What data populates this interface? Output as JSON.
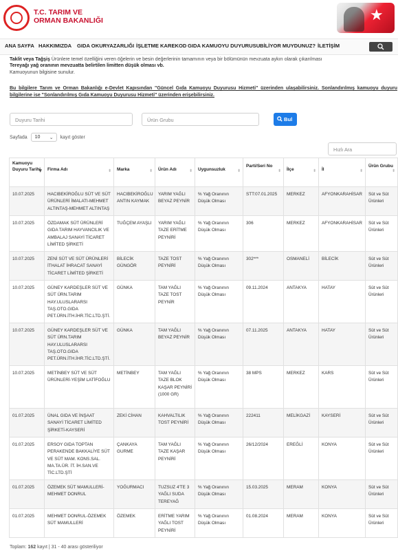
{
  "header": {
    "logo_line1": "T.C. TARIM VE",
    "logo_line2": "ORMAN BAKANLIĞI"
  },
  "nav": {
    "items": [
      "ANA SAYFA",
      "HAKKIMIZDA",
      "GIDA OKURYAZARLIĞI",
      "İŞLETME KAREKOD",
      "GIDA KAMUOYU DUYURUSU",
      "BİLİYOR MUYDUNUZ?",
      "İLETİŞİM"
    ],
    "search_icon": "search-icon"
  },
  "notice": {
    "line1_bold": "Taklit veya Tağşiş",
    "line1_rest": " Ürünlere temel özelliğini veren öğelerin ve besin değerlerinin tamamının veya bir bölümünün mevzuata aykırı olarak çıkarılması",
    "line2": "Tereyağı yağ oranının mevzuatta belirtilen limitten düşük olması vb.",
    "line3": "Kamuoyunun bilgisine sunulur."
  },
  "links_paragraph": "Bu bilgilere Tarım ve Orman Bakanlığı e-Devlet Kapısından \"Güncel Gıda Kamuoyu Duyurusu Hizmeti\" üzerinden ulaşabilirsiniz. Sonlandırılmış kamuoyu duyuru bilgilerine ise \"Sonlandırılmış Gıda Kamuoyu Duyurusu Hizmeti\" üzerinden erişebilirsiniz.",
  "filters": {
    "date_placeholder": "Duyuru Tarihi",
    "group_placeholder": "Ürün Grubu",
    "search_label": "Bul"
  },
  "pagesize": {
    "prefix": "Sayfada",
    "value": "10",
    "suffix": "kayıt göster"
  },
  "quick_search_placeholder": "Hızlı Ara",
  "table": {
    "columns": [
      "Kamuoyu Duyuru Tarihi",
      "Firma Adı",
      "Marka",
      "Ürün Adı",
      "Uygunsuzluk",
      "Parti/Seri No",
      "İlçe",
      "İl",
      "Ürün Grubu"
    ],
    "rows": [
      {
        "date": "10.07.2025",
        "firm": "HACIBEKİROĞLU SÜT VE SÜT ÜRÜNLERİ İMALATI-MEHMET ALTINTAŞ-MEHMET ALTINTAŞ",
        "brand": "HACIBEKİROĞLU ANTIN KAYMAK",
        "product": "YARIM YAĞLI BEYAZ PEYNİR",
        "issue": "% Yağ Oranının Düşük Olması",
        "lot": "STT:07.01.2025",
        "district": "MERKEZ",
        "city": "AFYONKARAHİSAR",
        "group": "Süt ve Süt Ürünleri"
      },
      {
        "date": "10.07.2025",
        "firm": "ÖZDAMAK SÜT ÜRÜNLERİ GIDA TARIM HAYVANCILIK VE AMBALAJ SANAYİ TİCARET LİMİTED ŞİRKETİ",
        "brand": "TUĞÇEM AYAŞLI",
        "product": "YARIM YAĞLI TAZE ERİTME PEYNİRİ",
        "issue": "% Yağ Oranının Düşük Olması",
        "lot": "306",
        "district": "MERKEZ",
        "city": "AFYONKARAHİSAR",
        "group": "Süt ve Süt Ürünleri"
      },
      {
        "date": "10.07.2025",
        "firm": "ZENİ SÜT VE SÜT ÜRÜNLERİ İTHALAT İHRACAT SANAYİ TİCARET LİMİTED ŞİRKETİ",
        "brand": "BİLECİK GÜNGÖR",
        "product": "TAZE TOST PEYNİRİ",
        "issue": "% Yağ Oranının Düşük Olması",
        "lot": "302***",
        "district": "OSMANELİ",
        "city": "BİLECİK",
        "group": "Süt ve Süt Ürünleri"
      },
      {
        "date": "10.07.2025",
        "firm": "GÜNEY KARDEŞLER SÜT VE SÜT ÜRN.TARIM HAY.ULUSLARARSI TAŞ.OTO.GIDA PET.ÜRN.İTH.İHR.TİC.LTD.ŞTİ.",
        "brand": "GÜNKA",
        "product": "TAM YAĞLI TAZE TOST PEYNİR",
        "issue": "% Yağ Oranının Düşük Olması",
        "lot": "09.11.2024",
        "district": "ANTAKYA",
        "city": "HATAY",
        "group": "Süt ve Süt Ürünleri"
      },
      {
        "date": "10.07.2025",
        "firm": "GÜNEY KARDEŞLER SÜT VE SÜT ÜRN.TARIM HAY.ULUSLARARSI TAŞ.OTO.GIDA PET.ÜRN.İTH.İHR.TİC.LTD.ŞTİ.",
        "brand": "GÜNKA",
        "product": "TAM YAĞLI BEYAZ PEYNİR",
        "issue": "% Yağ Oranının Düşük Olması",
        "lot": "07.11.2025",
        "district": "ANTAKYA",
        "city": "HATAY",
        "group": "Süt ve Süt Ürünleri"
      },
      {
        "date": "10.07.2025",
        "firm": "METİNBEY SÜT VE SÜT ÜRÜNLERİ-YEŞİM LATİFOĞLU",
        "brand": "METİNBEY",
        "product": "TAM YAĞLI TAZE BLOK KAŞAR PEYNİRİ (1000 GR)",
        "issue": "% Yağ Oranının Düşük Olması",
        "lot": "38 MPS",
        "district": "MERKEZ",
        "city": "KARS",
        "group": "Süt ve Süt Ürünleri"
      },
      {
        "date": "01.07.2025",
        "firm": "ÜNAL GIDA VE İNŞAAT SANAYİ TİCARET LİMİTED ŞİRKETİ-KAYSERİ",
        "brand": "ZEKİ CİHAN",
        "product": "KAHVALTILIK TOST PEYNİRİ",
        "issue": "% Yağ Oranının Düşük Olması",
        "lot": "222411",
        "district": "MELİKGAZİ",
        "city": "KAYSERİ",
        "group": "Süt ve Süt Ürünleri"
      },
      {
        "date": "01.07.2025",
        "firm": "ERSOY GIDA TOPTAN PERAKENDE BAKKALİYE SÜT VE SÜT MAM. KONS.SAL. MA.TA.ÜR. İT. İH.SAN.VE TİC.LTD.ŞTİ",
        "brand": "ÇANKAYA GURME",
        "product": "TAM YAĞLI TAZE KAŞAR PEYNİRİ",
        "issue": "% Yağ Oranının Düşük Olması",
        "lot": "26/12/2024",
        "district": "EREĞLİ",
        "city": "KONYA",
        "group": "Süt ve Süt Ürünleri"
      },
      {
        "date": "01.07.2025",
        "firm": "ÖZEMEK SÜT MAMULLERİ-MEHMET DONRUL",
        "brand": "YOĞURMACI",
        "product": "TUZSUZ 4'TE 3 YAĞLI SUDA TEREYAĞ",
        "issue": "% Yağ Oranının Düşük Olması",
        "lot": "15.03.2025",
        "district": "MERAM",
        "city": "KONYA",
        "group": "Süt ve Süt Ürünleri"
      },
      {
        "date": "01.07.2025",
        "firm": "MEHMET DONRUL-ÖZEMEK SÜT MAMULLERİ",
        "brand": "ÖZEMEK",
        "product": "ERİTME YARIM YAĞLI TOST PEYNİRİ",
        "issue": "% Yağ Oranının Düşük Olması",
        "lot": "01.08.2024",
        "district": "MERAM",
        "city": "KONYA",
        "group": "Süt ve Süt Ürünleri"
      }
    ]
  },
  "footer": {
    "prefix": "Toplam:",
    "total": "162",
    "suffix": "kayıt | 31 - 40 arası gösteriliyor"
  }
}
